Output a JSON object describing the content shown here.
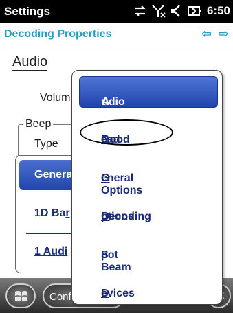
{
  "statusbar": {
    "title": "Settings",
    "time": "6:50"
  },
  "header": {
    "subtitle": "Decoding Properties",
    "back_arrow": "⇦",
    "forward_arrow": "⇨"
  },
  "background": {
    "heading": "Audio",
    "volume_label": "Volum",
    "beep_label": "Beep",
    "type_label": "Type",
    "underlay_selected": "Genera",
    "underlay_item_1": "1D Ba",
    "underlay_item_1_underlined": "r",
    "underlay_item_2": "1 Audi",
    "underlay_item_2_prefix": "1"
  },
  "menu": {
    "items": [
      {
        "pre": "",
        "ul": "A",
        "post": "udio"
      },
      {
        "pre": "Good ",
        "ul": "R",
        "post": "ead"
      },
      {
        "pre": "",
        "ul": "G",
        "post": "eneral Options"
      },
      {
        "pre": "Decoding ",
        "ul": "O",
        "post": "ptions"
      },
      {
        "pre": "",
        "ul": "S",
        "post": "pot Beam"
      },
      {
        "pre": "",
        "ul": "D",
        "post": "evices"
      }
    ]
  },
  "taskbar": {
    "conf_label": "Conf",
    "close_label": "ok"
  },
  "icons": {
    "status": [
      "sync-icon",
      "signal-off-icon",
      "volume-icon",
      "battery-icon"
    ],
    "start": "windows-logo-icon"
  },
  "colors": {
    "accent": "#2a9abf",
    "menu_text": "#1a2a7d",
    "selected_bg": "#2a4fbf"
  }
}
